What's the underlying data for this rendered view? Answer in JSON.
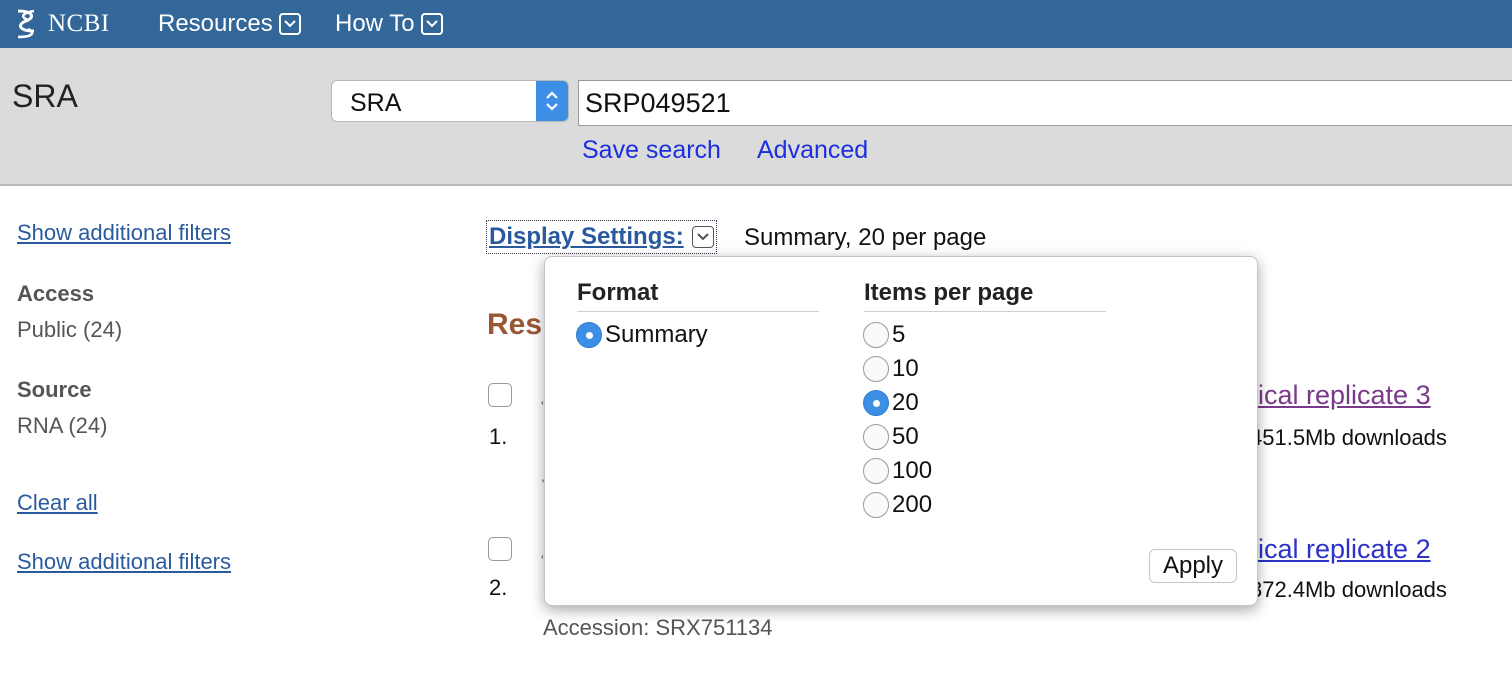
{
  "header": {
    "logo_text": "NCBI",
    "nav": [
      {
        "label": "Resources",
        "icon": "chevron-down-icon"
      },
      {
        "label": "How To",
        "icon": "chevron-down-icon"
      }
    ]
  },
  "search": {
    "db_title": "SRA",
    "db_select_value": "SRA",
    "query": "SRP049521",
    "save_search_label": "Save search",
    "advanced_label": "Advanced"
  },
  "sidebar": {
    "show_filters_top": "Show additional filters",
    "groups": [
      {
        "heading": "Access",
        "items": [
          "Public (24)"
        ]
      },
      {
        "heading": "Source",
        "items": [
          "RNA (24)"
        ]
      }
    ],
    "clear_all": "Clear all",
    "show_filters_bottom": "Show additional filters"
  },
  "main": {
    "display_settings_label": "Display Settings:",
    "display_settings_summary": "Summary, 20 per page",
    "results_heading": "Res",
    "results": [
      {
        "number": "1.",
        "title": "ical replicate 3",
        "meta": "451.5Mb downloads"
      },
      {
        "number": "2.",
        "title": "ical replicate 2",
        "meta": "372.4Mb downloads",
        "accession": "Accession: SRX751134"
      }
    ]
  },
  "popup": {
    "format_heading": "Format",
    "format_options": [
      {
        "label": "Summary",
        "selected": true
      }
    ],
    "items_heading": "Items per page",
    "items_options": [
      {
        "label": "5",
        "selected": false
      },
      {
        "label": "10",
        "selected": false
      },
      {
        "label": "20",
        "selected": true
      },
      {
        "label": "50",
        "selected": false
      },
      {
        "label": "100",
        "selected": false
      },
      {
        "label": "200",
        "selected": false
      }
    ],
    "apply_label": "Apply"
  },
  "colors": {
    "topbar": "#336699",
    "search_band": "#dbdbdb",
    "link_blue": "#1b2fe0",
    "sidebar_link": "#2a5a9e",
    "visited_link": "#7a3a8a",
    "results_heading": "#985735",
    "radio_selected": "#3d8fe6"
  }
}
